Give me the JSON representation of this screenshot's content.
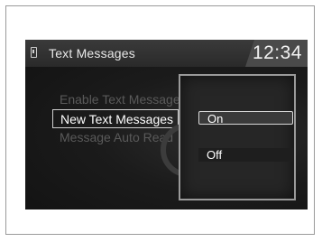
{
  "header": {
    "title": "Text Messages",
    "clock": "12:34",
    "icon": "phone-icon"
  },
  "menu": {
    "items": [
      {
        "label": "Enable Text Message",
        "state": "dimmed"
      },
      {
        "label": "New Text Messages",
        "state": "selected"
      },
      {
        "label": "Message Auto Read",
        "state": "dimmed"
      }
    ]
  },
  "popup": {
    "options": [
      {
        "label": "On",
        "state": "selected"
      },
      {
        "label": "Off",
        "state": "normal"
      }
    ]
  },
  "colors": {
    "screen_bg": "#1a1a1a",
    "text": "#ffffff",
    "dimmed_text": "#5a5a5a",
    "highlight_border": "#cfcfcf"
  }
}
